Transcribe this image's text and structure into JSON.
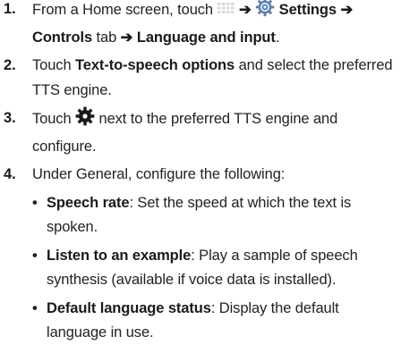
{
  "steps": [
    {
      "num": "1.",
      "t1": "From a Home screen, touch",
      "arrow1": "➔",
      "settings": "Settings",
      "arrow2": "➔",
      "controls": "Controls",
      "tab_word": "tab",
      "arrow3": "➔",
      "lang_input": "Language and input",
      "end": "."
    },
    {
      "num": "2.",
      "t1": "Touch",
      "tts_options": "Text-to-speech options",
      "t2": "and select the preferred TTS engine."
    },
    {
      "num": "3.",
      "t1": "Touch",
      "t2": "next to the preferred TTS engine and configure."
    },
    {
      "num": "4.",
      "t1": "Under General, configure the following:"
    }
  ],
  "bullets": [
    {
      "term": "Speech rate",
      "desc": ": Set the speed at which the text is spoken."
    },
    {
      "term": "Listen to an example",
      "desc": ": Play a sample of speech synthesis (available if voice data is installed)."
    },
    {
      "term": "Default language status",
      "desc": ": Display the default language in use."
    }
  ],
  "bullet_char": "•",
  "icons": {
    "apps": "apps-grid-icon",
    "settings": "settings-gear-icon",
    "gear": "gear-icon"
  }
}
